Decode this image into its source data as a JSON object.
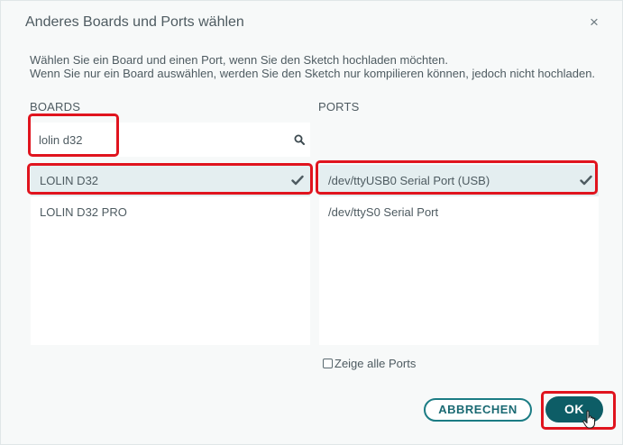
{
  "dialog": {
    "title": "Anderes Boards und Ports wählen",
    "close_symbol": "×",
    "description_line1": "Wählen Sie ein Board und einen Port, wenn Sie den Sketch hochladen möchten.",
    "description_line2": "Wenn Sie nur ein Board auswählen, werden Sie den Sketch nur kompilieren können, jedoch nicht hochladen."
  },
  "boards": {
    "header": "BOARDS",
    "search_value": "lolin d32",
    "items": [
      {
        "label": "LOLIN D32",
        "selected": true
      },
      {
        "label": "LOLIN D32 PRO",
        "selected": false
      }
    ]
  },
  "ports": {
    "header": "PORTS",
    "items": [
      {
        "label": "/dev/ttyUSB0 Serial Port (USB)",
        "selected": true
      },
      {
        "label": "/dev/ttyS0 Serial Port",
        "selected": false
      }
    ],
    "show_all_label": "Zeige alle Ports",
    "show_all_checked": false
  },
  "buttons": {
    "cancel": "ABBRECHEN",
    "ok": "OK"
  },
  "icons": {
    "search": "search-icon",
    "check": "checkmark-icon",
    "close": "close-icon",
    "cursor": "hand-pointer-icon"
  },
  "colors": {
    "accent": "#0d5d66",
    "highlight": "#e0141e",
    "selected_row": "#e4eef0"
  }
}
